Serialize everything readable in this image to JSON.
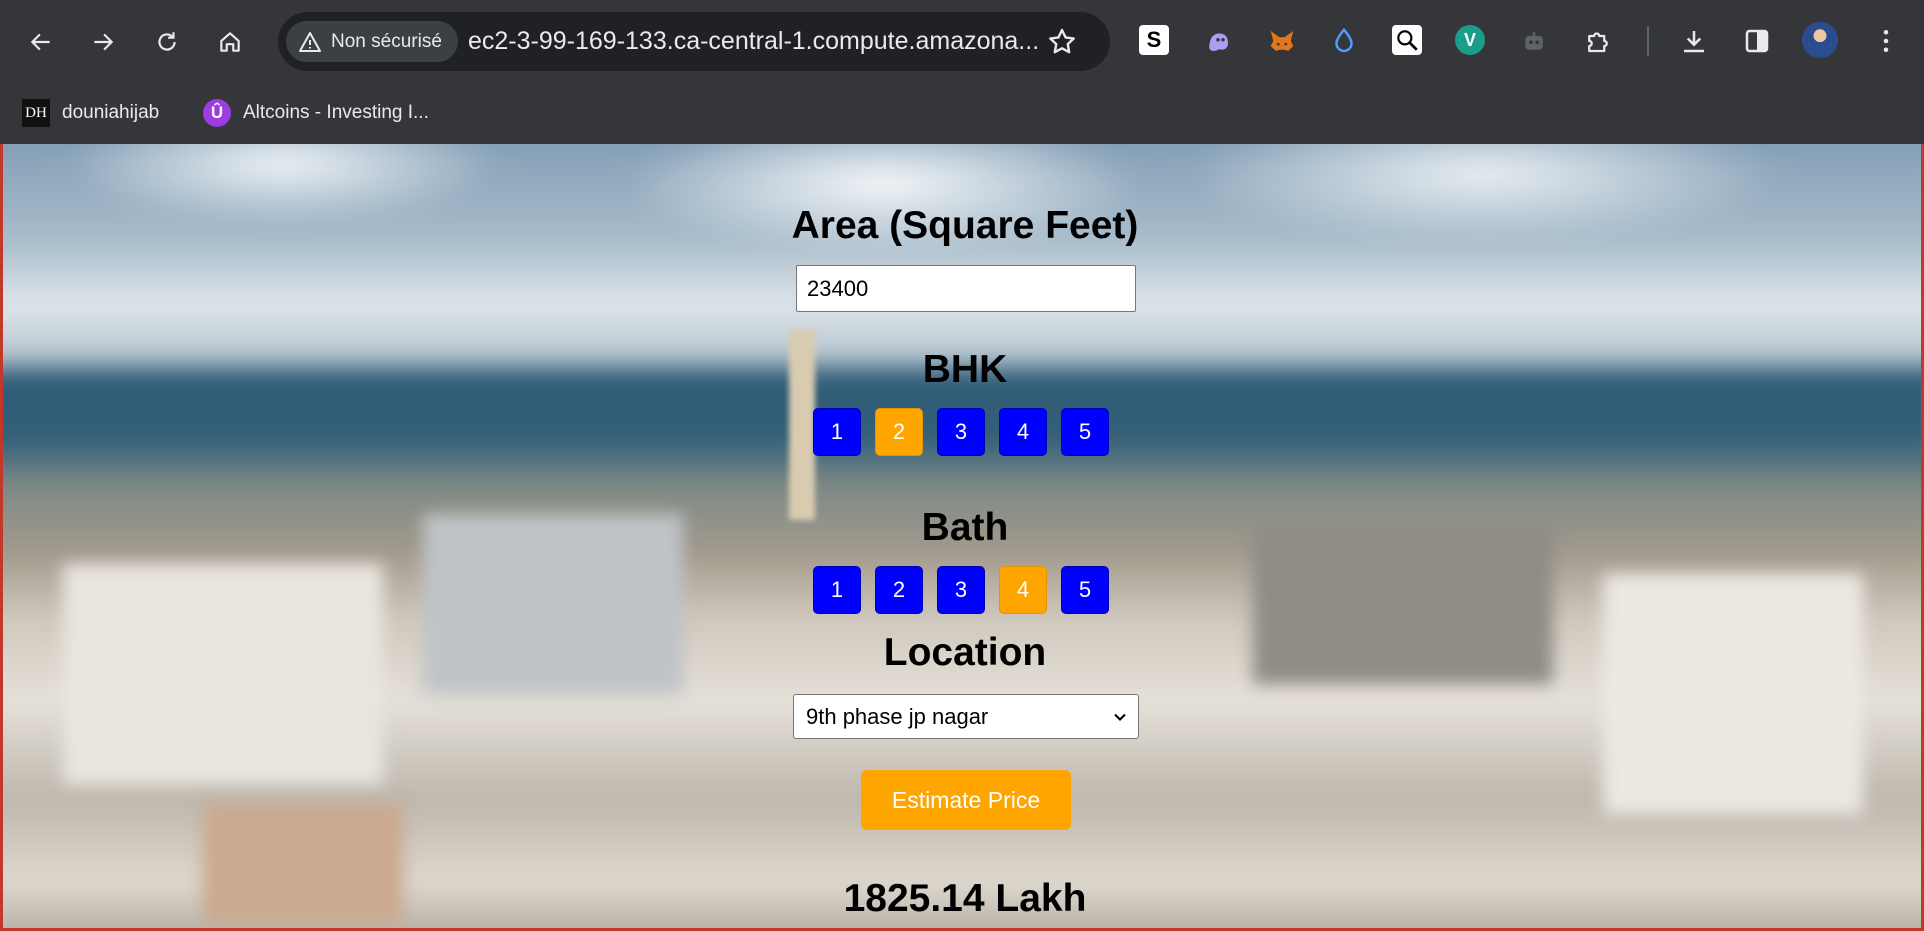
{
  "browser": {
    "security_label": "Non sécurisé",
    "url": "ec2-3-99-169-133.ca-central-1.compute.amazona...",
    "bookmarks": [
      {
        "badge": "DH",
        "label": "douniahijab"
      },
      {
        "badge": "Û",
        "label": "Altcoins - Investing I..."
      }
    ],
    "extensions": [
      "s-extension-icon",
      "ghost-extension-icon",
      "metamask-fox-icon",
      "droplet-extension-icon",
      "magnifier-extension-icon",
      "v-extension-icon",
      "robot-extension-icon",
      "puzzle-extensions-icon"
    ],
    "extension_badges": {
      "s": "S",
      "v": "V"
    }
  },
  "form": {
    "area_label": "Area (Square Feet)",
    "area_value": "23400",
    "bhk_label": "BHK",
    "bhk_options": [
      "1",
      "2",
      "3",
      "4",
      "5"
    ],
    "bhk_selected": "2",
    "bath_label": "Bath",
    "bath_options": [
      "1",
      "2",
      "3",
      "4",
      "5"
    ],
    "bath_selected": "4",
    "location_label": "Location",
    "location_value": "9th phase jp nagar",
    "estimate_label": "Estimate Price",
    "result": "1825.14 Lakh"
  },
  "colors": {
    "button_blue": "#0000ff",
    "selected_orange": "#ffa500",
    "chrome_bg": "#35363a"
  }
}
